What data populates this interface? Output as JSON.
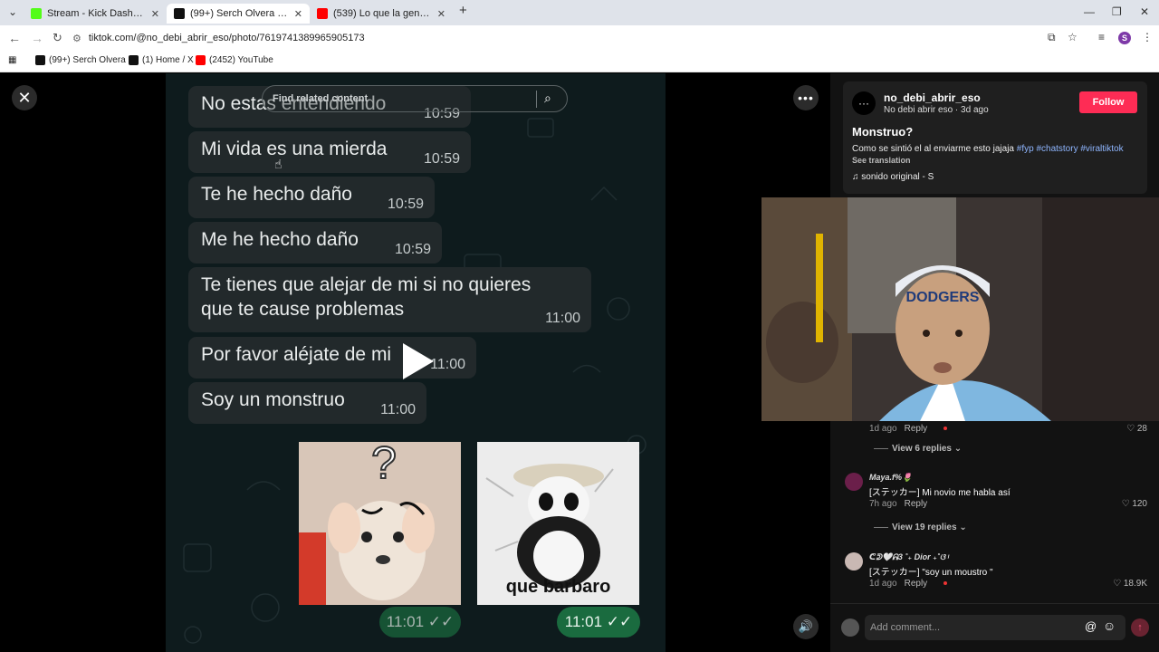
{
  "browser": {
    "tabs": [
      {
        "title": "Stream - Kick Dashboard",
        "color": "#53fc18"
      },
      {
        "title": "(99+) Serch Olvera (@serch",
        "color": "#111111"
      },
      {
        "title": "(539) Lo que la gente cuenta -",
        "color": "#ff0000"
      }
    ],
    "new_tab": "+",
    "url": "tiktok.com/@no_debi_abrir_eso/photo/7619741389965905173",
    "bookmarks": [
      {
        "title": "(99+) Serch Olvera (...",
        "color": "#111111"
      },
      {
        "title": "(1) Home / X",
        "color": "#111111"
      },
      {
        "title": "(2452) YouTube",
        "color": "#ff0000"
      }
    ],
    "profile_initial": "S"
  },
  "chat": {
    "search_placeholder": "Find related content",
    "messages": [
      {
        "text": "No estas entendiendo",
        "time": "10:59"
      },
      {
        "text": "Mi vida es una mierda",
        "time": "10:59"
      },
      {
        "text": "Te he hecho daño",
        "time": "10:59"
      },
      {
        "text": "Me he hecho daño",
        "time": "10:59"
      },
      {
        "text": "Te tienes que alejar de mi si no quieres",
        "text2": "que te cause problemas",
        "time": "11:00"
      },
      {
        "text": "Por favor aléjate de mi",
        "time": "11:00"
      },
      {
        "text": "Soy un monstruo",
        "time": "11:00"
      }
    ],
    "sticker1": {
      "time": "11:01 ✓✓"
    },
    "sticker2": {
      "caption": "que barbaro",
      "time": "11:01 ✓✓"
    }
  },
  "post": {
    "username": "no_debi_abrir_eso",
    "subline": "No debi abrir eso · 3d ago",
    "follow_label": "Follow",
    "title": "Monstruo?",
    "desc_text": "Como se sintió el al enviarme esto jajaja ",
    "desc_tags": "#fyp #chatstory #viraltiktok",
    "see_translation": "See translation",
    "music": "sonido original - S"
  },
  "comments": {
    "top_meta": "1d ago",
    "top_reply": "Reply",
    "top_likes": "28",
    "view_replies_1": "View 6 replies",
    "c1_name": "Maya.f%🌷",
    "c1_text": "[ステッカー] Mi novio me habla así",
    "c1_meta": "7h ago",
    "c1_reply": "Reply",
    "c1_likes": "120",
    "view_replies_2": "View 19 replies",
    "c2_name": "ᕦᕲ🤍ᕱ3 ˚₊ Dior ₊˚ଓ ᵎ",
    "c2_text": "[ステッカー] \"soy un moustro \"",
    "c2_meta": "1d ago",
    "c2_reply": "Reply",
    "c2_likes": "18.9K",
    "input_placeholder": "Add comment..."
  }
}
